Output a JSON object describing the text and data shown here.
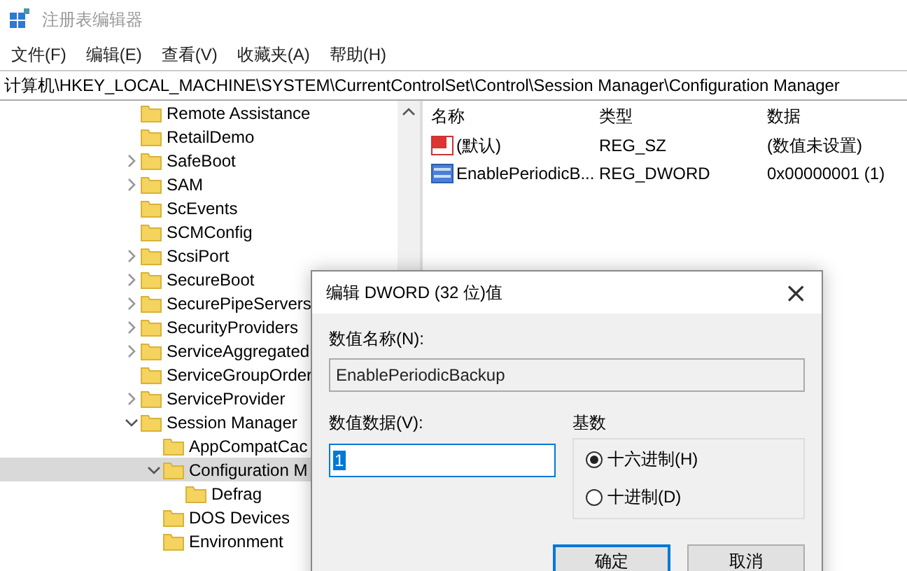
{
  "window": {
    "title": "注册表编辑器"
  },
  "menu": [
    "文件(F)",
    "编辑(E)",
    "查看(V)",
    "收藏夹(A)",
    "帮助(H)"
  ],
  "address": "计算机\\HKEY_LOCAL_MACHINE\\SYSTEM\\CurrentControlSet\\Control\\Session Manager\\Configuration Manager",
  "tree": [
    {
      "label": "Remote Assistance",
      "selected": false
    },
    {
      "label": "RetailDemo",
      "selected": false
    },
    {
      "label": "SafeBoot",
      "expanded": false,
      "selected": false
    },
    {
      "label": "SAM",
      "expanded": false,
      "selected": false
    },
    {
      "label": "ScEvents",
      "selected": false
    },
    {
      "label": "SCMConfig",
      "selected": false
    },
    {
      "label": "ScsiPort",
      "expanded": false,
      "selected": false
    },
    {
      "label": "SecureBoot",
      "expanded": false,
      "selected": false
    },
    {
      "label": "SecurePipeServers",
      "expanded": false,
      "selected": false
    },
    {
      "label": "SecurityProviders",
      "expanded": false,
      "selected": false
    },
    {
      "label": "ServiceAggregated",
      "expanded": false,
      "selected": false
    },
    {
      "label": "ServiceGroupOrder",
      "selected": false
    },
    {
      "label": "ServiceProvider",
      "expanded": false,
      "selected": false
    },
    {
      "label": "Session Manager",
      "expanded": true,
      "selected": false,
      "children": [
        {
          "label": "AppCompatCac",
          "selected": false
        },
        {
          "label": "Configuration M",
          "expanded": true,
          "selected": true,
          "children": [
            {
              "label": "Defrag",
              "selected": false
            }
          ]
        },
        {
          "label": "DOS Devices",
          "selected": false
        },
        {
          "label": "Environment",
          "selected": false
        }
      ]
    }
  ],
  "list": {
    "columns": [
      "名称",
      "类型",
      "数据"
    ],
    "rows": [
      {
        "kind": "string",
        "name": "(默认)",
        "type": "REG_SZ",
        "data": "(数值未设置)"
      },
      {
        "kind": "binary",
        "name": "EnablePeriodicB...",
        "type": "REG_DWORD",
        "data": "0x00000001 (1)"
      }
    ]
  },
  "dialog": {
    "title": "编辑 DWORD (32 位)值",
    "close": "×",
    "name_label": "数值名称(N):",
    "name_value": "EnablePeriodicBackup",
    "data_label": "数值数据(V):",
    "data_value": "1",
    "base": {
      "title": "基数",
      "options": [
        {
          "label": "十六进制(H)",
          "selected": true
        },
        {
          "label": "十进制(D)",
          "selected": false
        }
      ]
    },
    "buttons": [
      {
        "label": "确定",
        "default": true
      },
      {
        "label": "取消",
        "default": false
      }
    ]
  }
}
